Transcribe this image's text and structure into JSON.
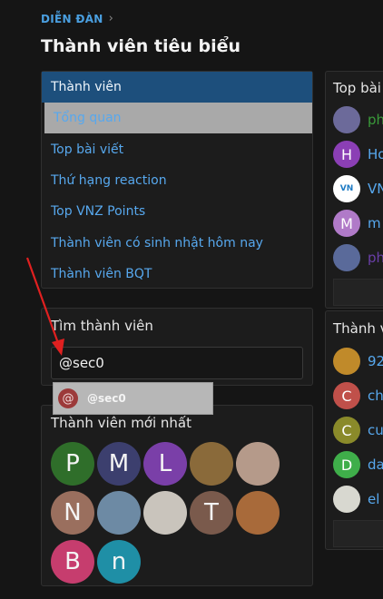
{
  "breadcrumb": {
    "label": "DIỄN ĐÀN"
  },
  "page": {
    "title": "Thành viên tiêu biểu"
  },
  "menu": {
    "items": [
      {
        "label": "Thành viên"
      },
      {
        "label": "Tổng quan"
      },
      {
        "label": "Top bài viết"
      },
      {
        "label": "Thứ hạng reaction"
      },
      {
        "label": "Top VNZ Points"
      },
      {
        "label": "Thành viên có sinh nhật hôm nay"
      },
      {
        "label": "Thành viên BQT"
      }
    ]
  },
  "find": {
    "title": "Tìm thành viên",
    "value": "@sec0"
  },
  "autocomplete": {
    "icon_letter": "@",
    "name": "@sec0"
  },
  "newest": {
    "title": "Thành viên mới nhất",
    "avatars": [
      {
        "letter": "P",
        "color": "#2f6e2a"
      },
      {
        "letter": "M",
        "color": "#3c3f6e"
      },
      {
        "letter": "L",
        "color": "#7a3fa8"
      },
      {
        "letter": "",
        "color": "#8a6a3a"
      },
      {
        "letter": "",
        "color": "#b59a8a"
      },
      {
        "letter": "N",
        "color": "#9a6f5e"
      },
      {
        "letter": "",
        "color": "#6d8aa4"
      },
      {
        "letter": "",
        "color": "#c9c4bc"
      },
      {
        "letter": "T",
        "color": "#7a5a4c"
      },
      {
        "letter": "",
        "color": "#a86a3a"
      },
      {
        "letter": "B",
        "color": "#c63d6e"
      },
      {
        "letter": "n",
        "color": "#1f8fa6"
      }
    ]
  },
  "top_posts": {
    "title": "Top bài",
    "items": [
      {
        "letter": "",
        "name": "ph",
        "color": "#6c6a9a",
        "name_color": "#3a9a3a"
      },
      {
        "letter": "H",
        "name": "Ho",
        "color": "#8b3fb5",
        "name_color": "#57a8ee"
      },
      {
        "letter": "VN",
        "name": "VN",
        "color": "#ffffff",
        "name_color": "#57a8ee"
      },
      {
        "letter": "M",
        "name": "m",
        "color": "#b07ac8",
        "name_color": "#57a8ee"
      },
      {
        "letter": "",
        "name": "ph",
        "color": "#5a6a9a",
        "name_color": "#6a3fa8"
      }
    ]
  },
  "members_panel": {
    "title": "Thành v",
    "items": [
      {
        "letter": "",
        "name": "92",
        "color": "#c08a2a"
      },
      {
        "letter": "C",
        "name": "ch",
        "color": "#c0504a"
      },
      {
        "letter": "C",
        "name": "cu",
        "color": "#8a8a2a"
      },
      {
        "letter": "D",
        "name": "da",
        "color": "#3fae4a"
      },
      {
        "letter": "",
        "name": "el",
        "color": "#d8d8d0"
      }
    ]
  }
}
